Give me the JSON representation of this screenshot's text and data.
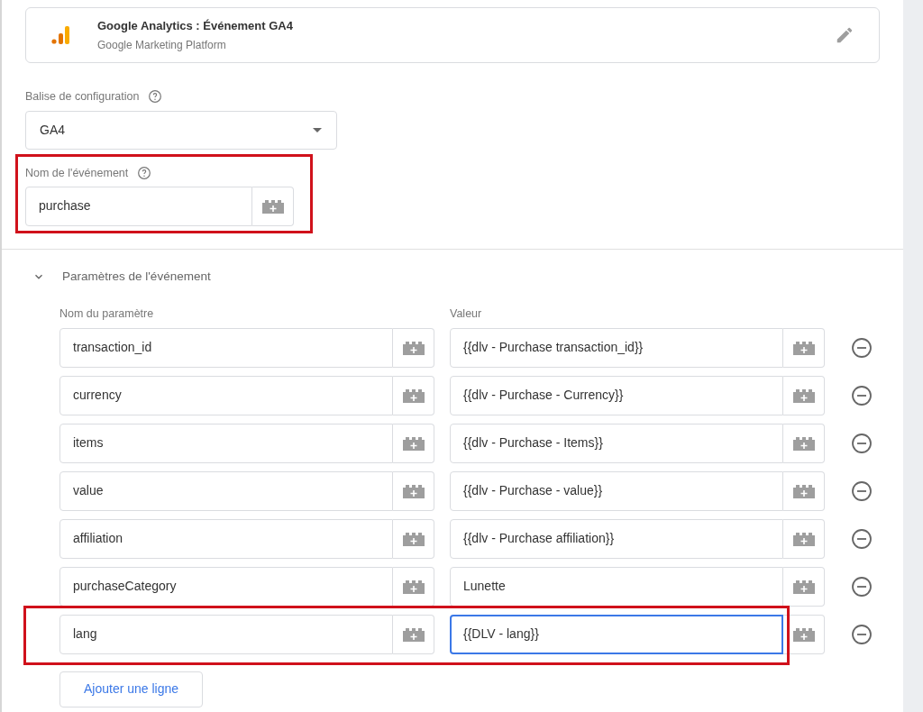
{
  "tag_type": {
    "title": "Google Analytics : Événement GA4",
    "subtitle": "Google Marketing Platform"
  },
  "config_tag": {
    "label": "Balise de configuration",
    "value": "GA4"
  },
  "event_name": {
    "label": "Nom de l'événement",
    "value": "purchase",
    "highlighted": true
  },
  "parameters": {
    "title": "Paramètres de l'événement",
    "expanded": true,
    "columns": [
      "Nom du paramètre",
      "Valeur"
    ],
    "rows": [
      {
        "name": "transaction_id",
        "value": "{{dlv - Purchase transaction_id}}",
        "focused": false,
        "highlighted": false
      },
      {
        "name": "currency",
        "value": "{{dlv - Purchase - Currency}}",
        "focused": false,
        "highlighted": false
      },
      {
        "name": "items",
        "value": "{{dlv - Purchase - Items}}",
        "focused": false,
        "highlighted": false
      },
      {
        "name": "value",
        "value": "{{dlv - Purchase - value}}",
        "focused": false,
        "highlighted": false
      },
      {
        "name": "affiliation",
        "value": "{{dlv - Purchase affiliation}}",
        "focused": false,
        "highlighted": false
      },
      {
        "name": "purchaseCategory",
        "value": "Lunette",
        "focused": false,
        "highlighted": false
      },
      {
        "name": "lang",
        "value": "{{DLV - lang}}",
        "focused": true,
        "highlighted": true
      }
    ],
    "add_button": "Ajouter une ligne"
  }
}
